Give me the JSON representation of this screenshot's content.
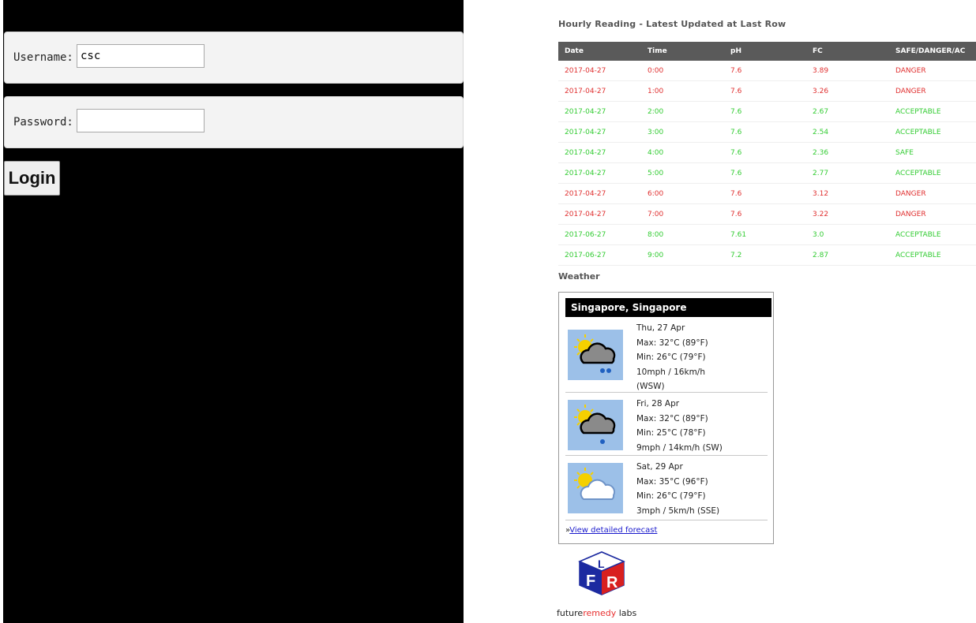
{
  "login": {
    "username_label": "Username:",
    "username_value": "csc",
    "password_label": "Password:",
    "password_value": "",
    "login_button": "Login"
  },
  "readings": {
    "title": "Hourly Reading - Latest Updated at Last Row",
    "columns": [
      "Date",
      "Time",
      "pH",
      "FC",
      "SAFE/DANGER/AC"
    ],
    "rows": [
      {
        "date": "2017-04-27",
        "time": "0:00",
        "ph": "7.6",
        "fc": "3.89",
        "status": "DANGER",
        "color": "#e03030"
      },
      {
        "date": "2017-04-27",
        "time": "1:00",
        "ph": "7.6",
        "fc": "3.26",
        "status": "DANGER",
        "color": "#e03030"
      },
      {
        "date": "2017-04-27",
        "time": "2:00",
        "ph": "7.6",
        "fc": "2.67",
        "status": "ACCEPTABLE",
        "color": "#33cc33"
      },
      {
        "date": "2017-04-27",
        "time": "3:00",
        "ph": "7.6",
        "fc": "2.54",
        "status": "ACCEPTABLE",
        "color": "#33cc33"
      },
      {
        "date": "2017-04-27",
        "time": "4:00",
        "ph": "7.6",
        "fc": "2.36",
        "status": "SAFE",
        "color": "#33cc33"
      },
      {
        "date": "2017-04-27",
        "time": "5:00",
        "ph": "7.6",
        "fc": "2.77",
        "status": "ACCEPTABLE",
        "color": "#33cc33"
      },
      {
        "date": "2017-04-27",
        "time": "6:00",
        "ph": "7.6",
        "fc": "3.12",
        "status": "DANGER",
        "color": "#e03030"
      },
      {
        "date": "2017-04-27",
        "time": "7:00",
        "ph": "7.6",
        "fc": "3.22",
        "status": "DANGER",
        "color": "#e03030"
      },
      {
        "date": "2017-06-27",
        "time": "8:00",
        "ph": "7.61",
        "fc": "3.0",
        "status": "ACCEPTABLE",
        "color": "#33cc33"
      },
      {
        "date": "2017-06-27",
        "time": "9:00",
        "ph": "7.2",
        "fc": "2.87",
        "status": "ACCEPTABLE",
        "color": "#33cc33"
      }
    ]
  },
  "weather": {
    "heading": "Weather",
    "location": "Singapore, Singapore",
    "days": [
      {
        "date": "Thu, 27 Apr",
        "max": "Max: 32°C (89°F)",
        "min": "Min: 26°C (79°F)",
        "wind": "10mph / 16km/h",
        "dir": "(WSW)",
        "icon": "sun-cloud-heavy-rain-icon"
      },
      {
        "date": "Fri, 28 Apr",
        "max": "Max: 32°C (89°F)",
        "min": "Min: 25°C (78°F)",
        "wind": "9mph / 14km/h (SW)",
        "icon": "sun-cloud-light-rain-icon"
      },
      {
        "date": "Sat, 29 Apr",
        "max": "Max: 35°C (96°F)",
        "min": "Min: 26°C (79°F)",
        "wind": "3mph / 5km/h (SSE)",
        "icon": "sun-cloud-icon"
      }
    ],
    "link_prefix": "»",
    "link_text": "View detailed forecast"
  },
  "brand": {
    "name_part1": "future",
    "name_part2": "remedy",
    "name_part3": " labs",
    "logo_letters": "FRL"
  }
}
